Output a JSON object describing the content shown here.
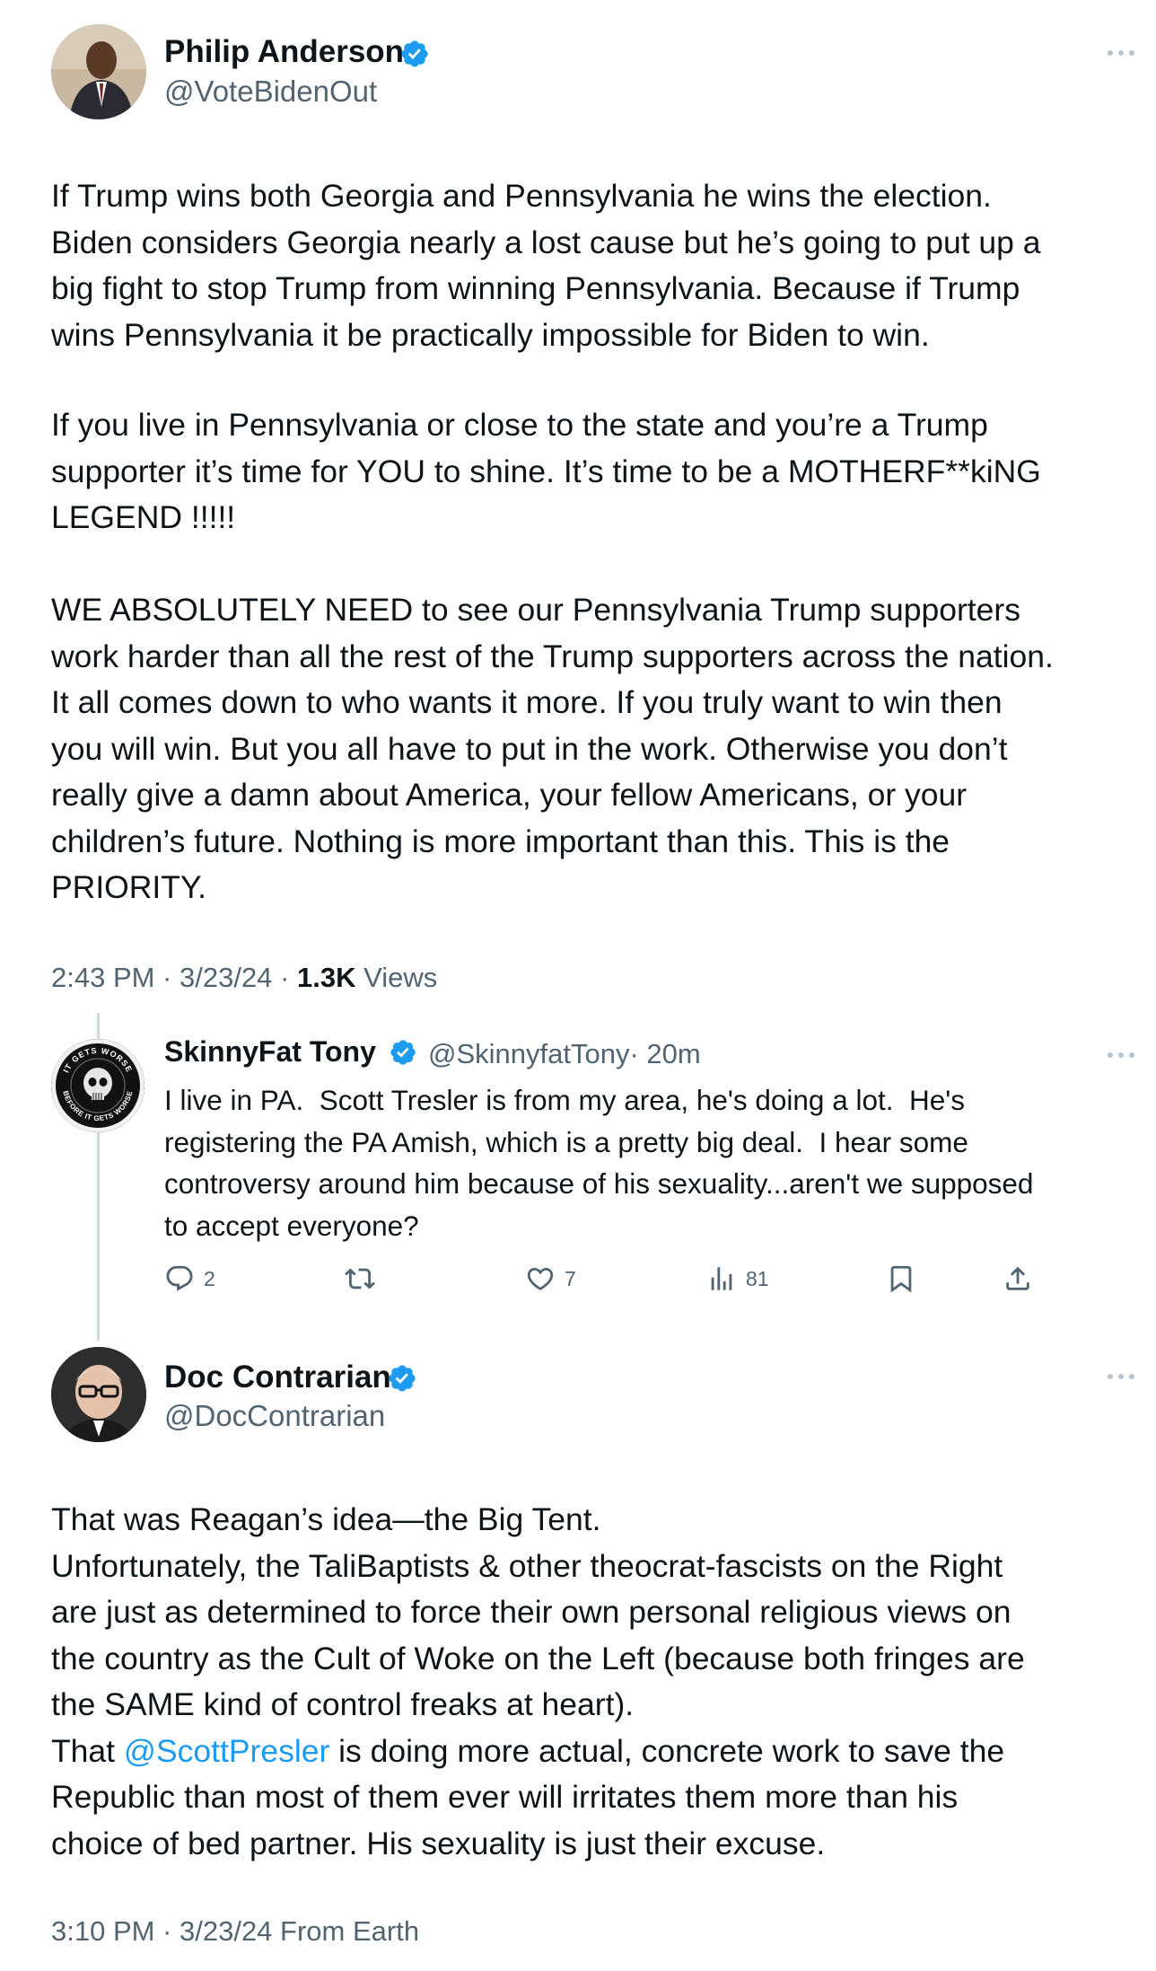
{
  "main_tweet": {
    "author_name": "Philip Anderson",
    "author_handle": "@VoteBidenOut",
    "paragraphs": [
      "If Trump wins both Georgia and Pennsylvania he wins the election.\nBiden considers Georgia nearly a lost cause but he’s going to put up a\nbig fight to stop Trump from winning Pennsylvania. Because if Trump\nwins Pennsylvania it be practically impossible for Biden to win.",
      "If you live in Pennsylvania or close to the state and you’re a Trump\nsupporter it’s time for YOU to shine. It’s time to be a MOTHERF**kiNG\nLEGEND !!!!!",
      "WE ABSOLUTELY NEED to see our Pennsylvania Trump supporters\nwork harder than all the rest of the Trump supporters across the nation.\nIt all comes down to who wants it more. If you truly want to win then\nyou will win. But you all have to put in the work. Otherwise you don’t\nreally give a damn about America, your fellow Americans, or your\nchildren’s future. Nothing is more important than this. This is the\nPRIORITY."
    ],
    "timestamp": "2:43 PM · 3/23/24 · ",
    "views_count": "1.3K",
    "views_label": " Views"
  },
  "reply": {
    "author_name": "SkinnyFat Tony",
    "author_handle": "@SkinnyfatTony",
    "time": "· 20m",
    "text": "I live in PA.  Scott Tresler is from my area, he's doing a lot.  He's\nregistering the PA Amish, which is a pretty big deal.  I hear some\ncontroversy around him because of his sexuality...aren't we supposed\nto accept everyone?",
    "avatar_text_top": "IT GETS WORSE",
    "avatar_text_bottom": "BEFORE IT GETS WORSE",
    "actions": {
      "reply_count": "2",
      "retweet_count": "",
      "like_count": "7",
      "views_count": "81"
    }
  },
  "quote_tweet": {
    "author_name": "Doc Contrarian",
    "author_handle": "@DocContrarian",
    "text_part1": "That was Reagan’s idea—the Big Tent.\nUnfortunately, the TaliBaptists & other theocrat-fascists on the Right\nare just as determined to force their own personal religious views on\nthe country as the Cult of Woke on the Left (because both fringes are\nthe SAME kind of control freaks at heart).\nThat ",
    "mention": "@ScottPresler",
    "text_part2": " is doing more actual, concrete work to save the\nRepublic than most of them ever will irritates them more than his\nchoice of bed partner. His sexuality is just their excuse.",
    "timestamp": "3:10 PM · 3/23/24 From Earth"
  },
  "colors": {
    "verified": "#1d9bf0",
    "secondary_text": "#536471",
    "thread_line": "#cfd9de"
  }
}
